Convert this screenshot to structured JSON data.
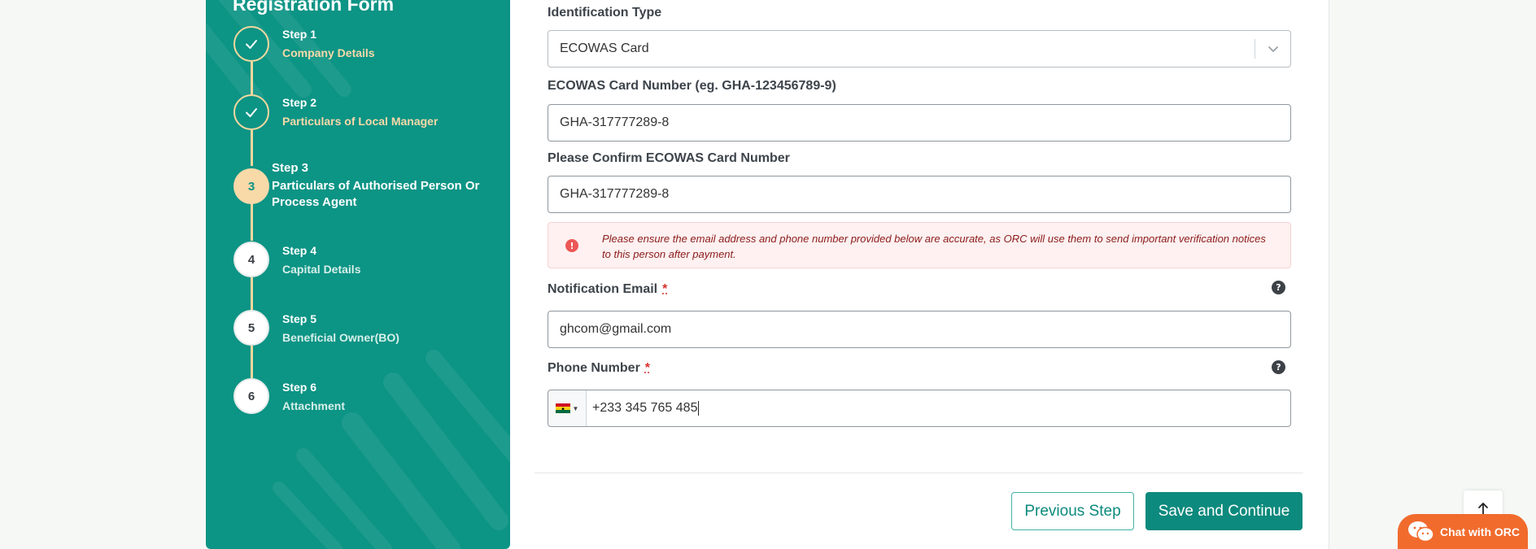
{
  "sidebar": {
    "title": "Registration Form",
    "steps": [
      {
        "label": "Step 1",
        "sub": "Company Details",
        "status": "done",
        "num": "1"
      },
      {
        "label": "Step 2",
        "sub": "Particulars of Local Manager",
        "status": "done",
        "num": "2"
      },
      {
        "label": "Step 3",
        "sub": "Particulars of Authorised Person Or Process Agent",
        "status": "active",
        "num": "3"
      },
      {
        "label": "Step 4",
        "sub": "Capital Details",
        "status": "pending",
        "num": "4"
      },
      {
        "label": "Step 5",
        "sub": "Beneficial Owner(BO)",
        "status": "pending",
        "num": "5"
      },
      {
        "label": "Step 6",
        "sub": "Attachment",
        "status": "pending",
        "num": "6"
      }
    ],
    "colors": {
      "background": "#0c9485",
      "accent": "#f8d9a8"
    }
  },
  "form": {
    "id_type": {
      "label": "Identification Type",
      "value": "ECOWAS Card"
    },
    "card_number": {
      "label": "ECOWAS Card Number (eg. GHA-123456789-9)",
      "value": "GHA-317777289-8"
    },
    "confirm_card_number": {
      "label": "Please Confirm ECOWAS Card Number",
      "value": "GHA-317777289-8"
    },
    "alert": {
      "icon": "exclamation-icon",
      "text": "Please ensure the email address and phone number provided below are accurate, as ORC will use them to send important verification notices to this person after payment."
    },
    "email": {
      "label": "Notification Email",
      "required_mark": "*",
      "value": "ghcom@gmail.com"
    },
    "phone": {
      "label": "Phone Number",
      "required_mark": "*",
      "value": "+233 345 765 485",
      "country_flag": "ghana-flag-icon"
    },
    "help_icon": "?",
    "alert_icon_glyph": "!"
  },
  "actions": {
    "previous": "Previous Step",
    "save": "Save and Continue"
  },
  "chat": {
    "label": "Chat with ORC",
    "color": "#f16b2d"
  },
  "colors": {
    "primary": "#0c8a7d",
    "required": "#d9302c",
    "alert_bg": "#fff1f1"
  }
}
